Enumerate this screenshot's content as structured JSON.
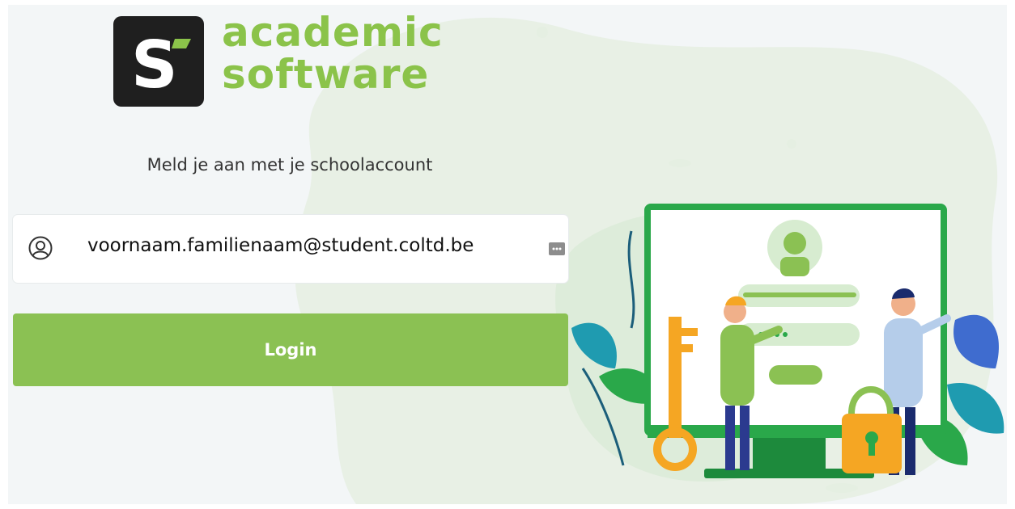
{
  "brand": {
    "mark": "S",
    "name_line1": "academic",
    "name_line2": "software",
    "accent_color": "#8bc34a"
  },
  "login": {
    "prompt": "Meld je aan met je schoolaccount",
    "username_value": "voornaam.familienaam@student.coltd.be",
    "username_icon": "user-circle-icon",
    "autofill_icon": "password-manager-icon",
    "button_label": "Login",
    "button_color": "#8bc153"
  },
  "illustration": {
    "name": "login-illustration"
  }
}
